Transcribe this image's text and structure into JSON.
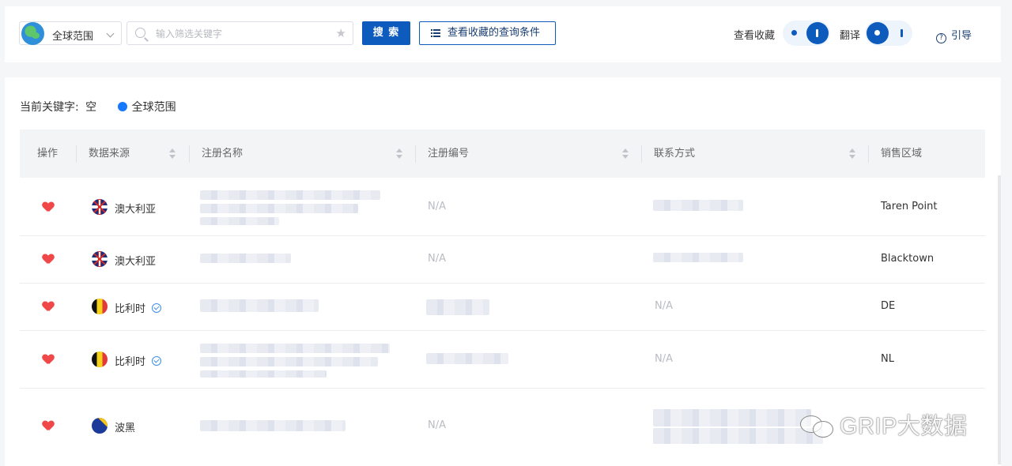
{
  "toolbar": {
    "scope": "全球范围",
    "search_placeholder": "输入筛选关键字",
    "search_button": "搜 索",
    "saved_queries_button": "查看收藏的查询条件",
    "view_favorites_label": "查看收藏",
    "translate_label": "翻译",
    "guide_label": "引导",
    "view_favorites_on": true,
    "translate_on": false
  },
  "filter": {
    "keyword_prefix": "当前关键字:",
    "keyword_value": "空",
    "scope_tag": "全球范围"
  },
  "table": {
    "columns": [
      "操作",
      "数据来源",
      "注册名称",
      "注册编号",
      "联系方式",
      "销售区域"
    ],
    "rows": [
      {
        "favorited": true,
        "flag": "au-flag-icon",
        "country": "澳大利亚",
        "verified": false,
        "name": "",
        "reg_no": "N/A",
        "contact": "",
        "region": "Taren Point"
      },
      {
        "favorited": true,
        "flag": "au-flag-icon",
        "country": "澳大利亚",
        "verified": false,
        "name": "",
        "reg_no": "N/A",
        "contact": "",
        "region": "Blacktown"
      },
      {
        "favorited": true,
        "flag": "be-flag-icon",
        "country": "比利时",
        "verified": true,
        "name": "",
        "reg_no": "",
        "contact": "N/A",
        "region": "DE"
      },
      {
        "favorited": true,
        "flag": "be-flag-icon",
        "country": "比利时",
        "verified": true,
        "name": "",
        "reg_no": "",
        "contact": "N/A",
        "region": "NL"
      },
      {
        "favorited": true,
        "flag": "ba-flag-icon",
        "country": "波黑",
        "verified": false,
        "name": "",
        "reg_no": "N/A",
        "contact": "",
        "region": ""
      }
    ]
  },
  "watermark": "GRIP大数据",
  "colors": {
    "primary": "#0d5bbd",
    "heart": "#f04848",
    "dot": "#1677ff"
  }
}
